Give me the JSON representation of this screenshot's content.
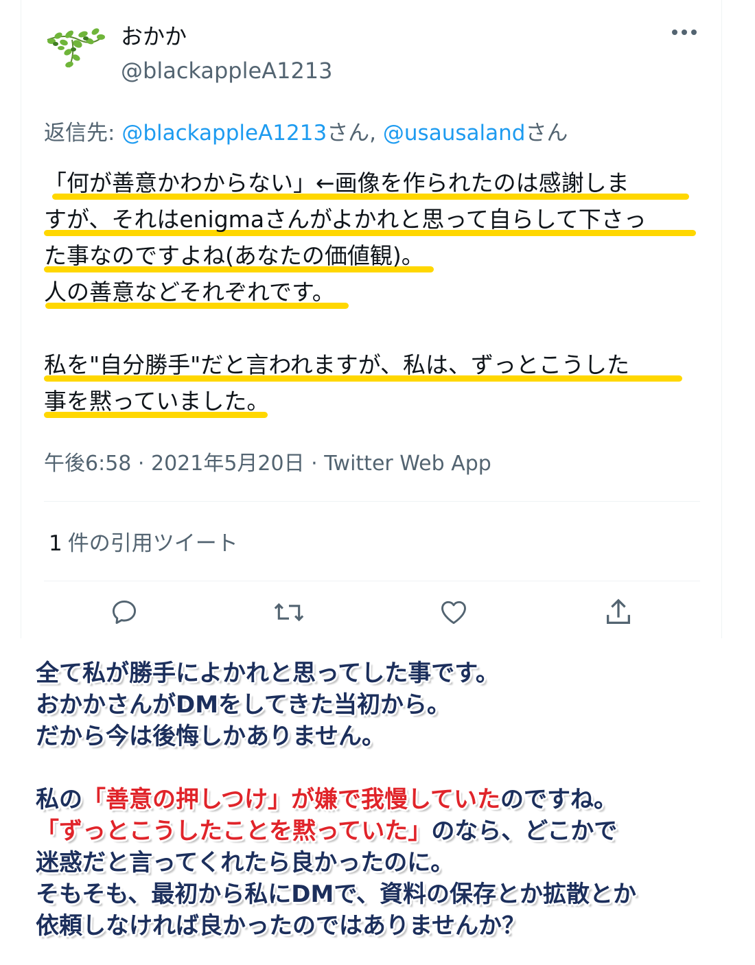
{
  "tweet": {
    "display_name": "おかか",
    "handle": "@blackappleA1213",
    "more_icon": "more-horizontal-icon",
    "reply_prefix": "返信先: ",
    "reply_mention1": "@blackappleA1213",
    "reply_suffix1": "さん, ",
    "reply_mention2": "@usausaland",
    "reply_suffix2": "さん",
    "lines": [
      "「何が善意かわからない」←画像を作られたのは感謝しま",
      "すが、それはenigmaさんがよかれと思って自らして下さっ",
      "た事なのですよね(あなたの価値観)。",
      "人の善意などそれぞれです。",
      "私を\"自分勝手\"だと言われますが、私は、ずっとこうした",
      "事を黙っていました。"
    ],
    "timestamp": "午後6:58 · 2021年5月20日 · Twitter Web App",
    "quote_count": "1",
    "quote_label": "件の引用ツイート",
    "highlight_color": "#ffd700"
  },
  "actions": {
    "reply_icon": "reply-icon",
    "retweet_icon": "retweet-icon",
    "like_icon": "heart-icon",
    "share_icon": "share-icon"
  },
  "overlay": {
    "line1": "全て私が勝手によかれと思ってした事です。",
    "line2": "おかかさんがDMをしてきた当初から。",
    "line3": "だから今は後悔しかありません。",
    "line4_a": "私の",
    "line4_red": "「善意の押しつけ」が嫌で我慢していた",
    "line4_b": "のですね。",
    "line5_red": "「ずっとこうしたことを黙っていた」",
    "line5_b": "のなら、どこかで",
    "line6": "迷惑だと言ってくれたら良かったのに。",
    "line7": "そもそも、最初から私にDMで、資料の保存とか拡散とか",
    "line8": "依頼しなければ良かったのではありませんか？",
    "text_color": "#1c2f5c",
    "accent_color": "#e0242a"
  }
}
